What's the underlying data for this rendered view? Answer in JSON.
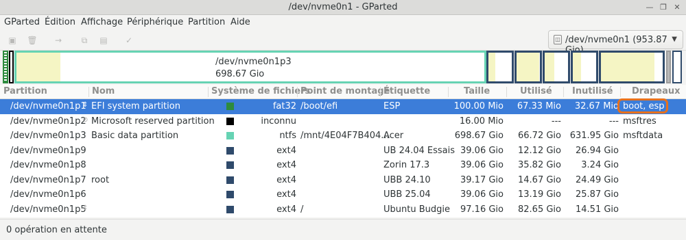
{
  "window": {
    "title": "/dev/nvme0n1 - GParted"
  },
  "menu": [
    "GParted",
    "Édition",
    "Affichage",
    "Périphérique",
    "Partition",
    "Aide"
  ],
  "device_selector": {
    "label": "/dev/nvme0n1 (953.87 Gio)"
  },
  "graph": {
    "selected_name": "/dev/nvme0n1p3",
    "selected_size": "698.67 Gio"
  },
  "columns": [
    "Partition",
    "Nom",
    "Système de fichiers",
    "Point de montage",
    "Étiquette",
    "Taille",
    "Utilisé",
    "Inutilisé",
    "Drapeaux"
  ],
  "colors": {
    "ntfs": "#66d3b3",
    "ext4": "#2f4a6b",
    "fat32": "#2e8b3e",
    "unknown": "#000000",
    "selection": "#3c7dd9",
    "highlight": "#e8711c"
  },
  "partitions": [
    {
      "partition": "/dev/nvme0n1p1",
      "name": "EFI system partition",
      "fs": "fat32",
      "fs_color": "#2e8b3e",
      "mount": "/boot/efi",
      "label": "ESP",
      "size": "100.00 Mio",
      "used": "67.33 Mio",
      "unused": "32.67 Mio",
      "flags": "boot, esp"
    },
    {
      "partition": "/dev/nvme0n1p2",
      "name": "Microsoft reserved partition",
      "fs": "inconnu",
      "fs_color": "#000000",
      "mount": "",
      "label": "",
      "size": "16.00 Mio",
      "used": "---",
      "unused": "---",
      "flags": "msftres"
    },
    {
      "partition": "/dev/nvme0n1p3",
      "name": "Basic data partition",
      "fs": "ntfs",
      "fs_color": "#66d3b3",
      "mount": "/mnt/4E04F7B404...",
      "label": "Acer",
      "size": "698.67 Gio",
      "used": "66.72 Gio",
      "unused": "631.95 Gio",
      "flags": "msftdata"
    },
    {
      "partition": "/dev/nvme0n1p9",
      "name": "",
      "fs": "ext4",
      "fs_color": "#2f4a6b",
      "mount": "",
      "label": "UB 24.04 Essais",
      "size": "39.06 Gio",
      "used": "12.12 Gio",
      "unused": "26.94 Gio",
      "flags": ""
    },
    {
      "partition": "/dev/nvme0n1p8",
      "name": "",
      "fs": "ext4",
      "fs_color": "#2f4a6b",
      "mount": "",
      "label": "Zorin 17.3",
      "size": "39.06 Gio",
      "used": "35.82 Gio",
      "unused": "3.24 Gio",
      "flags": ""
    },
    {
      "partition": "/dev/nvme0n1p7",
      "name": "root",
      "fs": "ext4",
      "fs_color": "#2f4a6b",
      "mount": "",
      "label": "UBB 24.10",
      "size": "39.17 Gio",
      "used": "14.67 Gio",
      "unused": "24.49 Gio",
      "flags": ""
    },
    {
      "partition": "/dev/nvme0n1p6",
      "name": "",
      "fs": "ext4",
      "fs_color": "#2f4a6b",
      "mount": "",
      "label": "UBB 25.04",
      "size": "39.06 Gio",
      "used": "13.19 Gio",
      "unused": "25.87 Gio",
      "flags": ""
    },
    {
      "partition": "/dev/nvme0n1p5",
      "name": "",
      "fs": "ext4",
      "fs_color": "#2f4a6b",
      "mount": "/",
      "label": "Ubuntu Budgie",
      "size": "97.16 Gio",
      "used": "82.65 Gio",
      "unused": "14.51 Gio",
      "flags": ""
    }
  ],
  "status": {
    "text": "0 opération en attente"
  }
}
